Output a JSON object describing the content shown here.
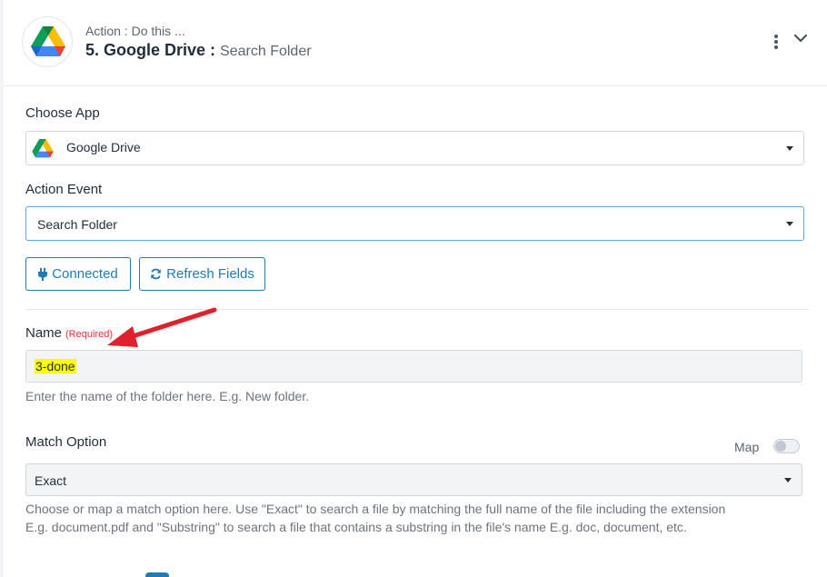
{
  "header": {
    "subtitle": "Action : Do this ...",
    "title": "5. Google Drive : ",
    "event": "Search Folder",
    "app_icon": "google-drive-icon"
  },
  "choose_app": {
    "label": "Choose App",
    "value": "Google Drive",
    "icon": "google-drive-icon"
  },
  "action_event": {
    "label": "Action Event",
    "value": "Search Folder"
  },
  "buttons": {
    "connected": "Connected",
    "connected_icon": "plug-icon",
    "refresh": "Refresh Fields",
    "refresh_icon": "refresh-icon"
  },
  "name_field": {
    "label": "Name",
    "required": "(Required)",
    "value": "3-done",
    "help": "Enter the name of the folder here. E.g. New folder."
  },
  "match_option": {
    "label": "Match Option",
    "map_label": "Map",
    "map_enabled": false,
    "value": "Exact",
    "help_line1": "Choose or map a match option here. Use \"Exact\" to search a file by matching the full name of the file including the extension",
    "help_line2": "E.g. document.pdf and \"Substring\" to search a file that contains a substring in the file's name E.g. doc, document, etc."
  },
  "colors": {
    "accent": "#1f7bb8",
    "required": "#e0303a",
    "highlight": "#ffff00",
    "annotation_arrow": "#e0202a"
  }
}
